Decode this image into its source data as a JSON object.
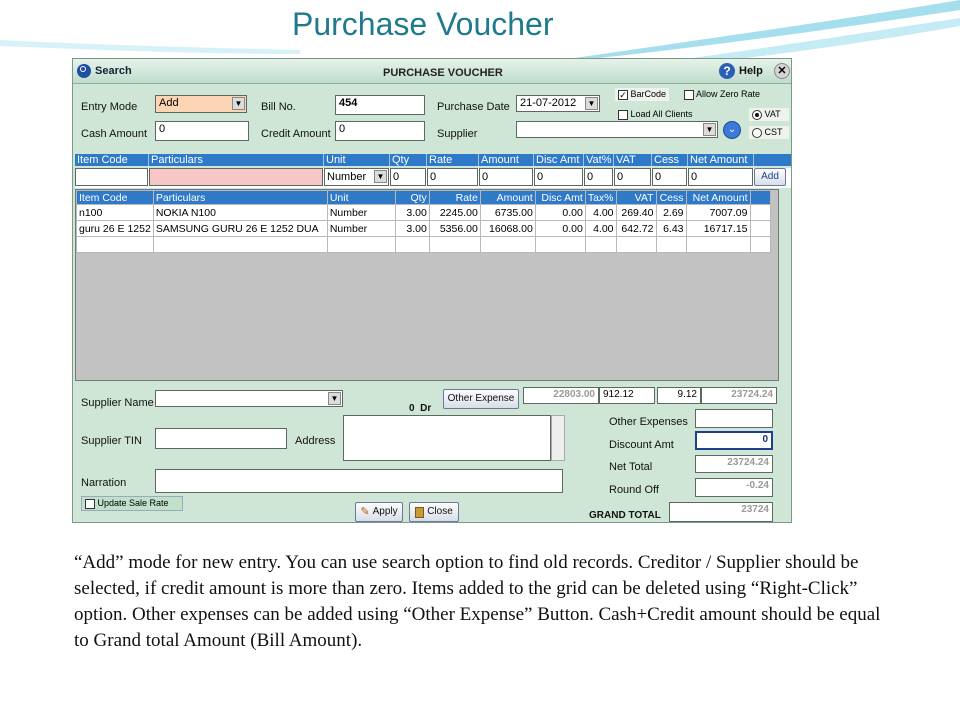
{
  "slide": {
    "title": "Purchase Voucher",
    "caption": "“Add” mode for new entry.  You can use search option to find old records.  Creditor / Supplier should be selected, if credit amount is more than zero.  Items added to the grid can be deleted using “Right-Click” option.  Other expenses can be added using “Other Expense” Button.  Cash+Credit amount should be equal to Grand total Amount (Bill Amount)."
  },
  "window": {
    "search_label": "Search",
    "title": "PURCHASE VOUCHER",
    "help_label": "Help"
  },
  "form": {
    "entry_mode_label": "Entry Mode",
    "entry_mode_value": "Add",
    "bill_no_label": "Bill No.",
    "bill_no_value": "454",
    "purchase_date_label": "Purchase Date",
    "purchase_date_value": "21-07-2012",
    "barcode_label": "BarCode",
    "allow_zero_rate_label": "Allow Zero Rate",
    "load_all_clients_label": "Load All Clients",
    "vat_label": "VAT",
    "cst_label": "CST",
    "cash_amount_label": "Cash Amount",
    "cash_amount_value": "0",
    "credit_amount_label": "Credit Amount",
    "credit_amount_value": "0",
    "supplier_label": "Supplier",
    "supplier_value": ""
  },
  "entry": {
    "headers": [
      "Item Code",
      "Particulars",
      "Unit",
      "Qty",
      "Rate",
      "Amount",
      "Disc Amt",
      "Vat%",
      "VAT",
      "Cess",
      "Net Amount"
    ],
    "values": [
      "",
      "",
      "Number",
      "0",
      "0",
      "0",
      "0",
      "0",
      "0",
      "0",
      "0"
    ],
    "add_label": "Add"
  },
  "grid": {
    "headers": [
      "Item Code",
      "Particulars",
      "Unit",
      "Qty",
      "Rate",
      "Amount",
      "Disc Amt",
      "Tax%",
      "VAT",
      "Cess",
      "Net Amount"
    ],
    "rows": [
      [
        "n100",
        "NOKIA N100",
        "Number",
        "3.00",
        "2245.00",
        "6735.00",
        "0.00",
        "4.00",
        "269.40",
        "2.69",
        "7007.09"
      ],
      [
        "guru 26 E 1252",
        "SAMSUNG GURU 26 E 1252 DUA",
        "Number",
        "3.00",
        "5356.00",
        "16068.00",
        "0.00",
        "4.00",
        "642.72",
        "6.43",
        "16717.15"
      ]
    ]
  },
  "footer": {
    "supplier_name_label": "Supplier Name",
    "balance_value": "0",
    "balance_suffix": "Dr",
    "other_expense_button": "Other Expense",
    "total_amount": "22803.00",
    "total_vat": "912.12",
    "total_cess": "9.12",
    "total_net": "23724.24",
    "supplier_tin_label": "Supplier TIN",
    "address_label": "Address",
    "narration_label": "Narration",
    "update_sale_rate_label": "Update Sale Rate",
    "apply_button": "Apply",
    "close_button": "Close",
    "other_expenses_label": "Other Expenses",
    "other_expenses_value": "",
    "discount_amt_label": "Discount Amt",
    "discount_amt_value": "0",
    "net_total_label": "Net Total",
    "net_total_value": "23724.24",
    "round_off_label": "Round Off",
    "round_off_value": "-0.24",
    "grand_total_label": "GRAND TOTAL",
    "grand_total_value": "23724"
  }
}
